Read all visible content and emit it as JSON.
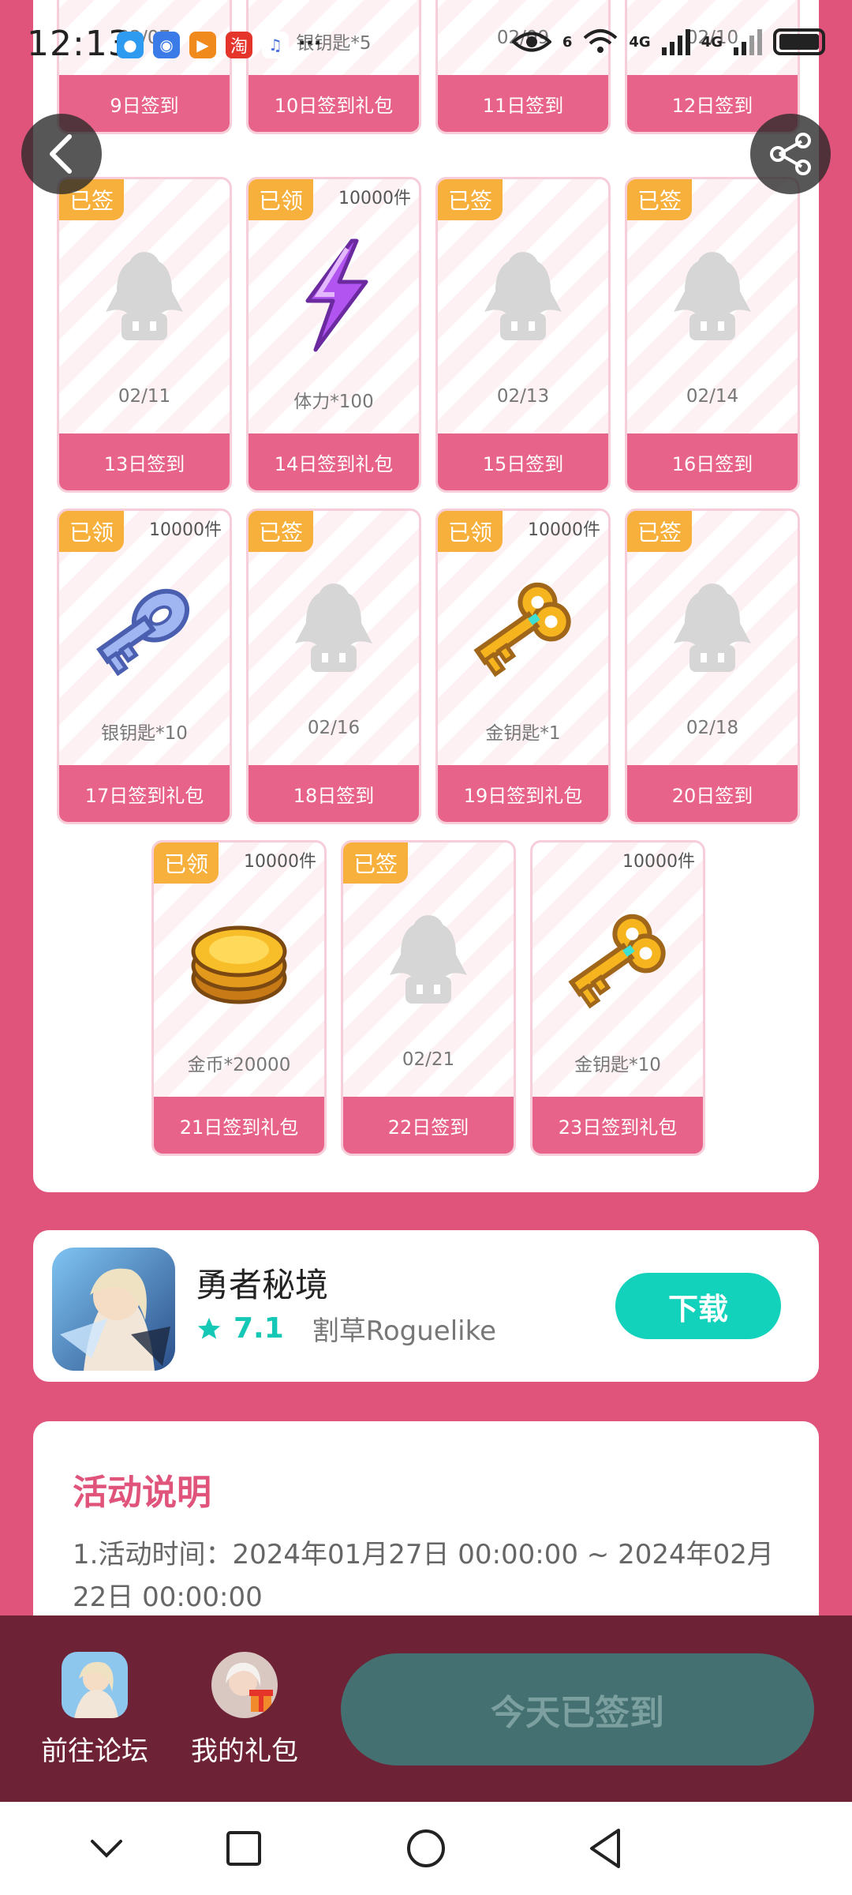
{
  "status_bar": {
    "time": "12:13",
    "notification_icons": [
      {
        "name": "message-icon",
        "color": "#2f9bf0",
        "glyph": "●"
      },
      {
        "name": "browser-icon",
        "color": "#3b7be8",
        "glyph": "◉"
      },
      {
        "name": "video-app-icon",
        "color": "#f08a1c",
        "glyph": "▶"
      },
      {
        "name": "taobao-icon",
        "color": "#e5342a",
        "glyph": "淘"
      },
      {
        "name": "music-icon",
        "color": "#ffffff",
        "glyph": "♫"
      }
    ],
    "more": "···",
    "wifi_tag": "6",
    "network_1": "4G",
    "network_2": "4G"
  },
  "calendar": {
    "rows": [
      {
        "cards": [
          {
            "status": "",
            "qty": "",
            "label": "02/07",
            "footer": "9日签到",
            "art": "hidden"
          },
          {
            "status": "",
            "qty": "",
            "label": "银钥匙*5",
            "footer": "10日签到礼包",
            "art": "hidden"
          },
          {
            "status": "",
            "qty": "",
            "label": "02/09",
            "footer": "11日签到",
            "art": "hidden"
          },
          {
            "status": "",
            "qty": "",
            "label": "02/10",
            "footer": "12日签到",
            "art": "hidden"
          }
        ]
      },
      {
        "cards": [
          {
            "status": "已签",
            "qty": "",
            "label": "02/11",
            "footer": "13日签到",
            "art": "placeholder"
          },
          {
            "status": "已领",
            "qty": "10000件",
            "label": "体力*100",
            "footer": "14日签到礼包",
            "art": "lightning"
          },
          {
            "status": "已签",
            "qty": "",
            "label": "02/13",
            "footer": "15日签到",
            "art": "placeholder"
          },
          {
            "status": "已签",
            "qty": "",
            "label": "02/14",
            "footer": "16日签到",
            "art": "placeholder"
          }
        ]
      },
      {
        "cards": [
          {
            "status": "已领",
            "qty": "10000件",
            "label": "银钥匙*10",
            "footer": "17日签到礼包",
            "art": "silver-key"
          },
          {
            "status": "已签",
            "qty": "",
            "label": "02/16",
            "footer": "18日签到",
            "art": "placeholder"
          },
          {
            "status": "已领",
            "qty": "10000件",
            "label": "金钥匙*1",
            "footer": "19日签到礼包",
            "art": "gold-key"
          },
          {
            "status": "已签",
            "qty": "",
            "label": "02/18",
            "footer": "20日签到",
            "art": "placeholder"
          }
        ]
      },
      {
        "cards": [
          {
            "status": "已领",
            "qty": "10000件",
            "label": "金币*20000",
            "footer": "21日签到礼包",
            "art": "coins"
          },
          {
            "status": "已签",
            "qty": "",
            "label": "02/21",
            "footer": "22日签到",
            "art": "placeholder"
          },
          {
            "status": "",
            "qty": "10000件",
            "label": "金钥匙*10",
            "footer": "23日签到礼包",
            "art": "gold-key"
          }
        ]
      }
    ]
  },
  "app_promo": {
    "name": "勇者秘境",
    "score": "7.1",
    "genre": "割草Roguelike",
    "download_label": "下载"
  },
  "rules": {
    "title": "活动说明",
    "text": "1.活动时间：2024年01月27日 00:00:00 ~ 2024年02月22日 00:00:00"
  },
  "bottom_bar": {
    "forum_label": "前往论坛",
    "gifts_label": "我的礼包",
    "signin_label": "今天已签到"
  },
  "colors": {
    "background": "#e0537a",
    "card_footer": "#e86389",
    "status_tag": "#f7b03c",
    "download": "#13d2bc",
    "bottom_bar": "#6e2235",
    "signin_button": "#457071"
  }
}
